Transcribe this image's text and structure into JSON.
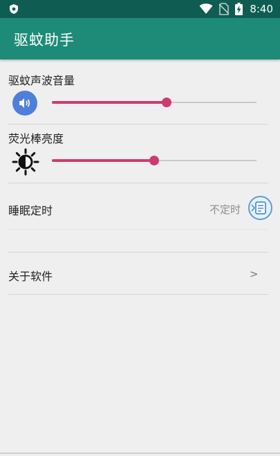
{
  "status_bar": {
    "time": "8:40",
    "icons": [
      "shield-icon",
      "wifi-icon",
      "no-sim-icon",
      "battery-charging-icon"
    ]
  },
  "app_bar": {
    "title": "驱蚊助手"
  },
  "volume": {
    "label": "驱蚊声波音量",
    "icon": "speaker-icon",
    "level": 0.56
  },
  "brightness": {
    "label": "荧光棒亮度",
    "icon": "sun-icon",
    "level": 0.5
  },
  "sleep_timer": {
    "label": "睡眠定时",
    "value": "不定时",
    "icon": "timer-list-icon"
  },
  "about": {
    "label": "关于软件",
    "arrow": ">"
  },
  "colors": {
    "status_bar": "#0f5d52",
    "app_bar": "#1e8b78",
    "accent": "#d03a72",
    "volume_icon_bg": "#4f7fd9",
    "background": "#efefef"
  }
}
